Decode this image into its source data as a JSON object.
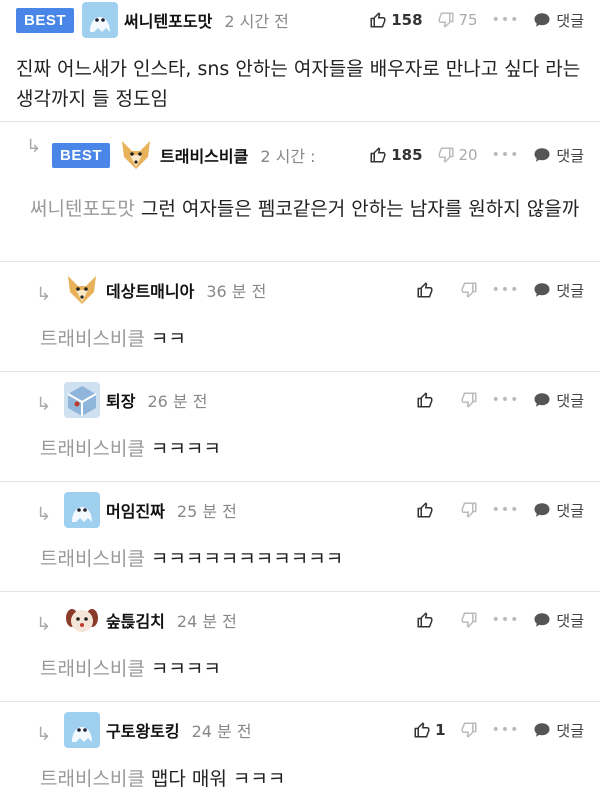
{
  "comments": [
    {
      "best": "BEST",
      "nick": "써니텐포도맛",
      "time": "2 시간 전",
      "up": "158",
      "down": "75",
      "reply": "댓글",
      "text": "진짜 어느새가 인스타, sns 안하는 여자들을 배우자로 만나고 싶다 라는 생각까지 들 정도임"
    },
    {
      "best": "BEST",
      "nick": "트래비스비클",
      "time": "2 시간 :",
      "up": "185",
      "down": "20",
      "reply": "댓글",
      "mention": "써니텐포도맛",
      "text": "그런 여자들은 펨코같은거 안하는 남자를 원하지 않을까"
    }
  ],
  "replies": [
    {
      "nick": "데상트매니아",
      "time": "36 분 전",
      "up": "",
      "reply": "댓글",
      "mention": "트래비스비클",
      "text": "ㅋㅋ",
      "avatar": "dog"
    },
    {
      "nick": "퇴장",
      "time": "26 분 전",
      "up": "",
      "reply": "댓글",
      "mention": "트래비스비클",
      "text": "ㅋㅋㅋㅋ",
      "avatar": "cube"
    },
    {
      "nick": "머임진짜",
      "time": "25 분 전",
      "up": "",
      "reply": "댓글",
      "mention": "트래비스비클",
      "text": "ㅋㅋㅋㅋㅋㅋㅋㅋㅋㅋㅋ",
      "avatar": "ghost"
    },
    {
      "nick": "숲튽김치",
      "time": "24 분 전",
      "up": "",
      "reply": "댓글",
      "mention": "트래비스비클",
      "text": "ㅋㅋㅋㅋ",
      "avatar": "puppy"
    },
    {
      "nick": "구토왕토킹",
      "time": "24 분 전",
      "up": "1",
      "reply": "댓글",
      "mention": "트래비스비클",
      "text": "맵다 매워 ㅋㅋㅋ",
      "avatar": "ghost"
    }
  ],
  "colors": {
    "best_badge": "#4a86e8",
    "mention": "#999999",
    "time": "#888888"
  }
}
